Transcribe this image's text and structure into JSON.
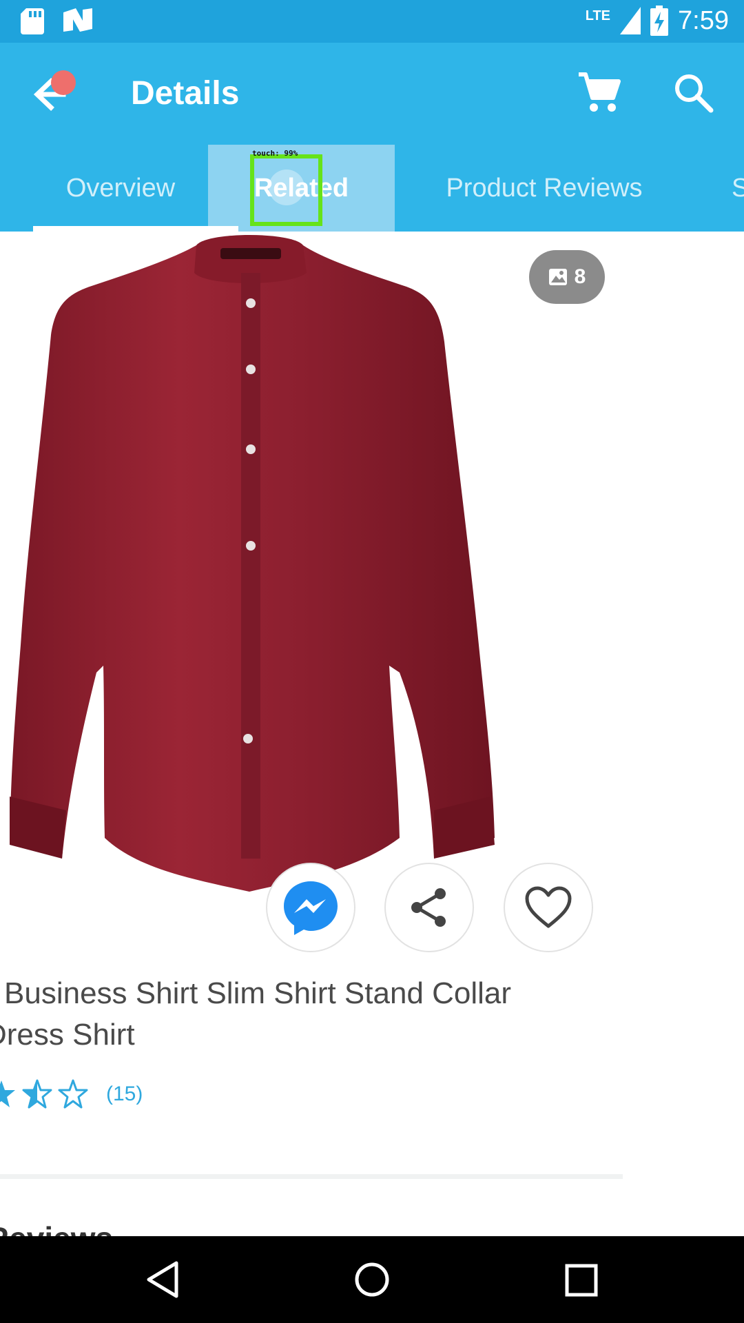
{
  "status_bar": {
    "time": "7:59",
    "network": "LTE",
    "icons": [
      "sd-card-icon",
      "n-app-icon",
      "signal-icon",
      "battery-charging-icon"
    ]
  },
  "app_bar": {
    "title": "Details",
    "back_icon": "arrow-left-icon",
    "cart_icon": "cart-icon",
    "search_icon": "search-icon"
  },
  "tabs": [
    {
      "label": "Overview",
      "selected": true
    },
    {
      "label": "Related",
      "selected": false
    },
    {
      "label": "Product Reviews",
      "selected": false
    },
    {
      "label": "S",
      "selected": false
    }
  ],
  "touch_overlay": {
    "label": "touch: 99%"
  },
  "product": {
    "image_count": "8",
    "title_line1": "Business Shirt Slim Shirt Stand Collar",
    "title_line2": "Dress Shirt",
    "rating": 1.5,
    "rating_count": "(15)",
    "shirt_color": "#8e1f2e"
  },
  "actions": [
    {
      "name": "messenger",
      "icon": "messenger-icon"
    },
    {
      "name": "share",
      "icon": "share-icon"
    },
    {
      "name": "wishlist",
      "icon": "heart-icon"
    }
  ],
  "section_heading": "Reviews",
  "colors": {
    "status_bar": "#1fa3dc",
    "app_bar": "#2fb5e8",
    "accent": "#2fa8de",
    "messenger": "#1f8ef1"
  }
}
